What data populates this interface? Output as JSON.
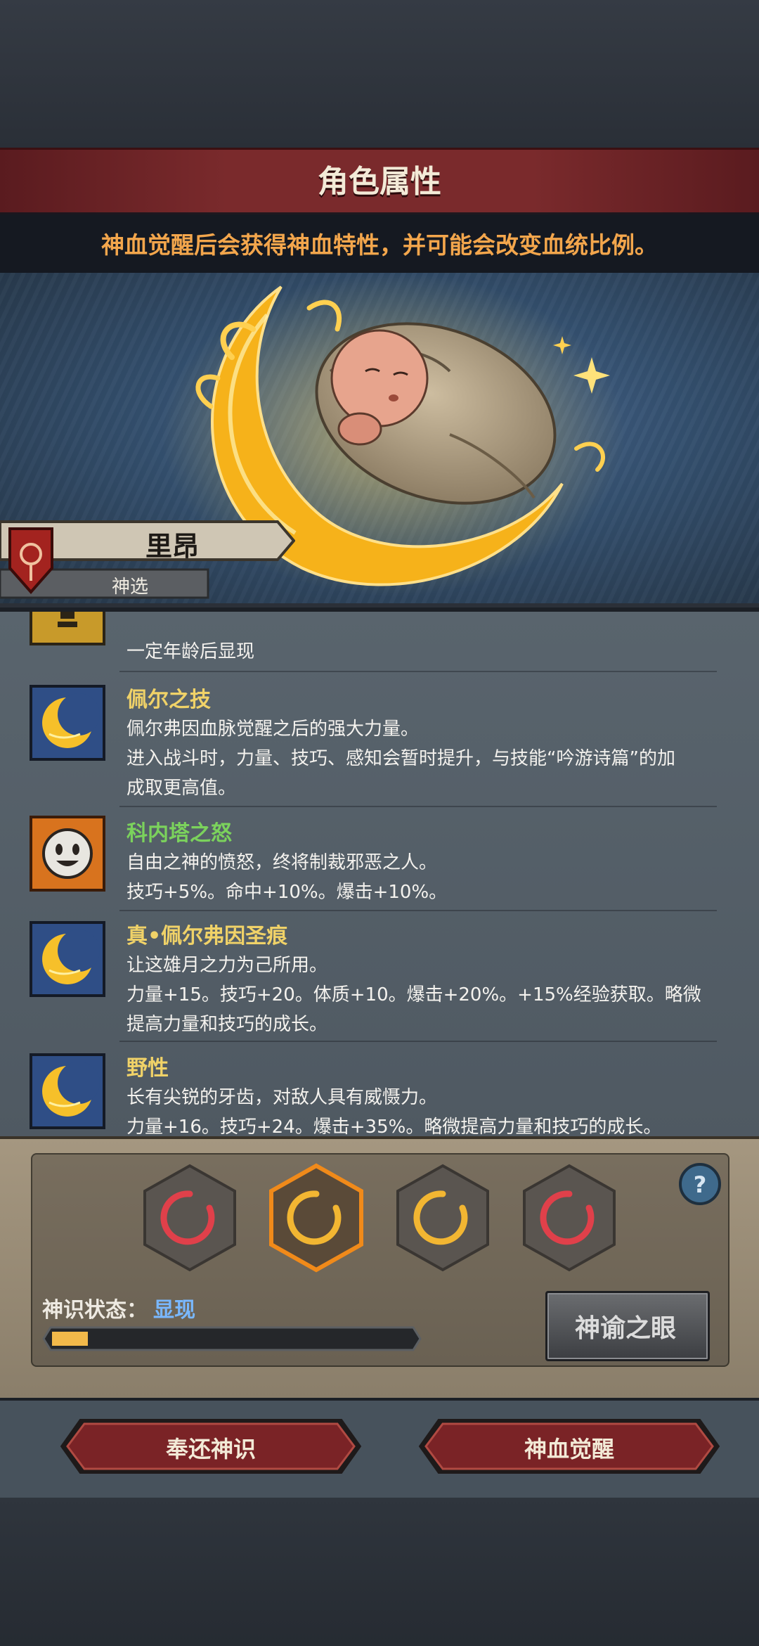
{
  "header": {
    "title": "角色属性",
    "subtitle": "神血觉醒后会获得神血特性，并可能会改变血统比例。"
  },
  "character": {
    "name": "里昂",
    "class": "神选"
  },
  "traits": [
    {
      "icon": "tower-icon",
      "title": "",
      "lines": [
        "一定年龄后显现"
      ]
    },
    {
      "icon": "moon-icon",
      "title": "佩尔之技",
      "lines": [
        "佩尔弗因血脉觉醒之后的强大力量。",
        "进入战斗时，力量、技巧、感知会暂时提升，与技能“吟游诗篇”的加",
        "成取更高值。"
      ]
    },
    {
      "icon": "smiley-icon",
      "title": "科内塔之怒",
      "lines": [
        "自由之神的愤怒，终将制裁邪恶之人。",
        "技巧+5%。命中+10%。爆击+10%。"
      ]
    },
    {
      "icon": "moon-icon",
      "title": "真•佩尔弗因圣痕",
      "lines": [
        "让这雄月之力为己所用。",
        "力量+15。技巧+20。体质+10。爆击+20%。+15%经验获取。略微",
        "提高力量和技巧的成长。"
      ]
    },
    {
      "icon": "moon-icon",
      "title": "野性",
      "lines": [
        "长有尖锐的牙齿，对敌人具有威慑力。",
        "力量+16。技巧+24。爆击+35%。略微提高力量和技巧的成长。"
      ]
    }
  ],
  "bloodline": {
    "slots": [
      {
        "icon": "crescent-red-icon",
        "color": "#e0404a",
        "selected": false
      },
      {
        "icon": "crescent-gold-icon",
        "color": "#f2b632",
        "selected": true
      },
      {
        "icon": "crescent-gold-icon",
        "color": "#f2b632",
        "selected": false
      },
      {
        "icon": "crescent-red-icon",
        "color": "#e0404a",
        "selected": false
      }
    ],
    "state_label": "神识状态：",
    "state_value": "显现",
    "progress": 0.1,
    "oracle_button": "神谕之眼",
    "help_icon": "?"
  },
  "actions": {
    "return_button": "奉还神识",
    "awaken_button": "神血觉醒"
  },
  "colors": {
    "accent_gold": "#f0d268",
    "subtitle_orange": "#f3a64c",
    "green_title": "#7bd25c",
    "state_blue": "#79b8ff",
    "banner_red": "#7a2a2c"
  }
}
